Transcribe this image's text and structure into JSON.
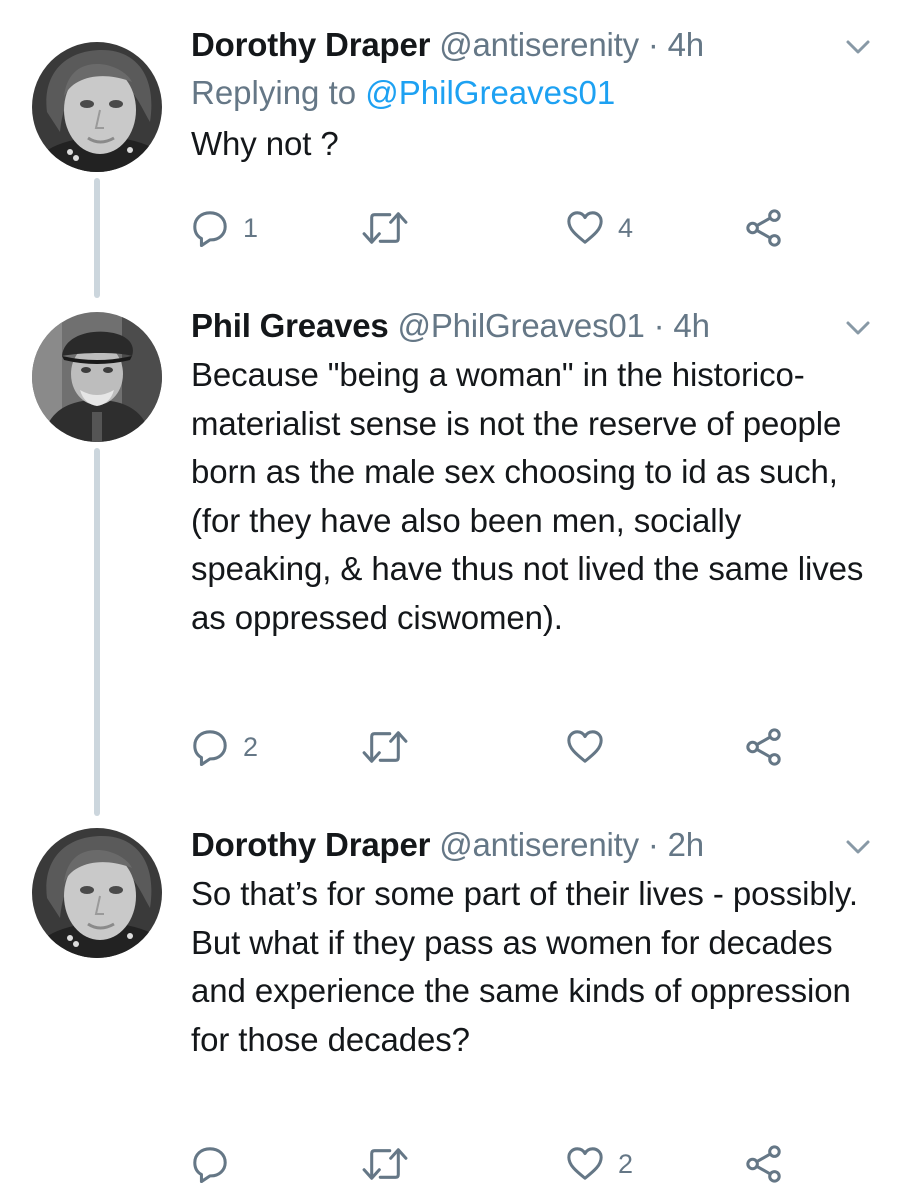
{
  "tweets": [
    {
      "name": "Dorothy Draper",
      "handle": "@antiserenity",
      "separator": "·",
      "time": "4h",
      "replying_prefix": "Replying to ",
      "replying_to": "@PhilGreaves01",
      "text": "Why not ?",
      "replies": "1",
      "retweets": "",
      "likes": "4",
      "avatar_icon": "avatar-woman-photo"
    },
    {
      "name": "Phil Greaves",
      "handle": "@PhilGreaves01",
      "separator": "·",
      "time": "4h",
      "text": "Because \"being a woman\" in the historico-materialist sense is not the reserve of people born as the male sex choosing to id as such, (for they have also been men, socially speaking, & have thus not lived the same lives as oppressed ciswomen).",
      "replies": "2",
      "retweets": "",
      "likes": "",
      "avatar_icon": "avatar-man-photo"
    },
    {
      "name": "Dorothy Draper",
      "handle": "@antiserenity",
      "separator": "·",
      "time": "2h",
      "text": "So that’s for some part of their lives - possibly. But what if they pass as women for decades and experience the same kinds of oppression for those decades?",
      "replies": "",
      "retweets": "",
      "likes": "2",
      "avatar_icon": "avatar-woman-photo"
    }
  ],
  "icons": {
    "reply": "reply-icon",
    "retweet": "retweet-icon",
    "like": "heart-icon",
    "share": "share-icon",
    "more": "chevron-down-icon"
  },
  "colors": {
    "text": "#14171a",
    "secondary": "#657786",
    "link": "#1da1f2",
    "thread_line": "#ccd6dd"
  }
}
